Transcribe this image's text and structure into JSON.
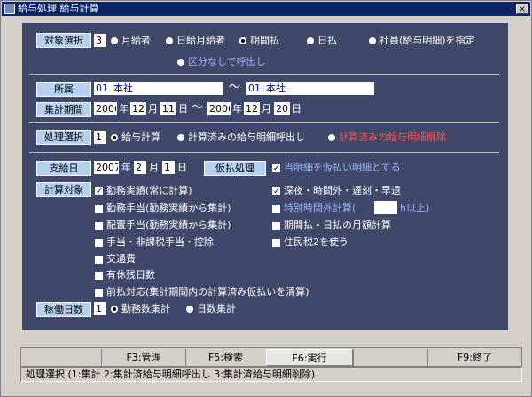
{
  "window": {
    "title": "給与処理  給与計算",
    "close": "×"
  },
  "target": {
    "label": "対象選択",
    "value": "3",
    "opt1": "月給者",
    "opt2": "日給月給者",
    "opt3": "期間払",
    "opt4": "日払",
    "opt5": "社員(給与明細)を指定",
    "opt6": "区分なしで呼出し"
  },
  "affiliation": {
    "label": "所属",
    "from_code": "01",
    "from_name": "本社",
    "tilde": "〜",
    "to_code": "01",
    "to_name": "本社"
  },
  "period": {
    "label": "集計期間",
    "from_y": "2006",
    "year": "年",
    "from_m": "12",
    "month": "月",
    "from_d": "11",
    "day": "日",
    "tilde": "〜",
    "to_y": "2006",
    "to_m": "12",
    "to_d": "20"
  },
  "process": {
    "label": "処理選択",
    "value": "1",
    "opt1": "給与計算",
    "opt2": "計算済みの給与明細呼出し",
    "opt3": "計算済みの給与明細削除"
  },
  "payday": {
    "label": "支給日",
    "y": "2007",
    "year": "年",
    "m": "2",
    "month": "月",
    "d": "1",
    "day": "日"
  },
  "provisional": {
    "label": "仮払処理",
    "check": "当明細を仮払い明細とする"
  },
  "calc": {
    "label": "計算対象",
    "items": [
      "勤務実績(常に計算)",
      "勤務手当(勤務実績から集計)",
      "配置手当(勤務実績から集計)",
      "手当・非課税手当・控除",
      "交通費",
      "有休残日数",
      "前払対応(集計期間内の計算済み仮払いを清算)"
    ],
    "right_items": [
      "深夜・時間外・遅刻・早退",
      "特別時間外計算(",
      "h以上)",
      "期間払・日払の月額計算",
      "住民税2を使う"
    ]
  },
  "workdays": {
    "label": "稼働日数",
    "value": "1",
    "opt1": "勤務数集計",
    "opt2": "日数集計"
  },
  "fkeys": {
    "f3": "F3:管理",
    "f5": "F5:検索",
    "f6": "F6:実行",
    "f9": "F9:終了"
  },
  "status": "処理選択 (1:集計 2:集計済給与明細呼出し 3:集計済給与明細削除)",
  "colors": {
    "panel": "#404869",
    "label_bg": "#b4d2f0",
    "red": "#ff5050",
    "blue": "#9cb4ff"
  }
}
